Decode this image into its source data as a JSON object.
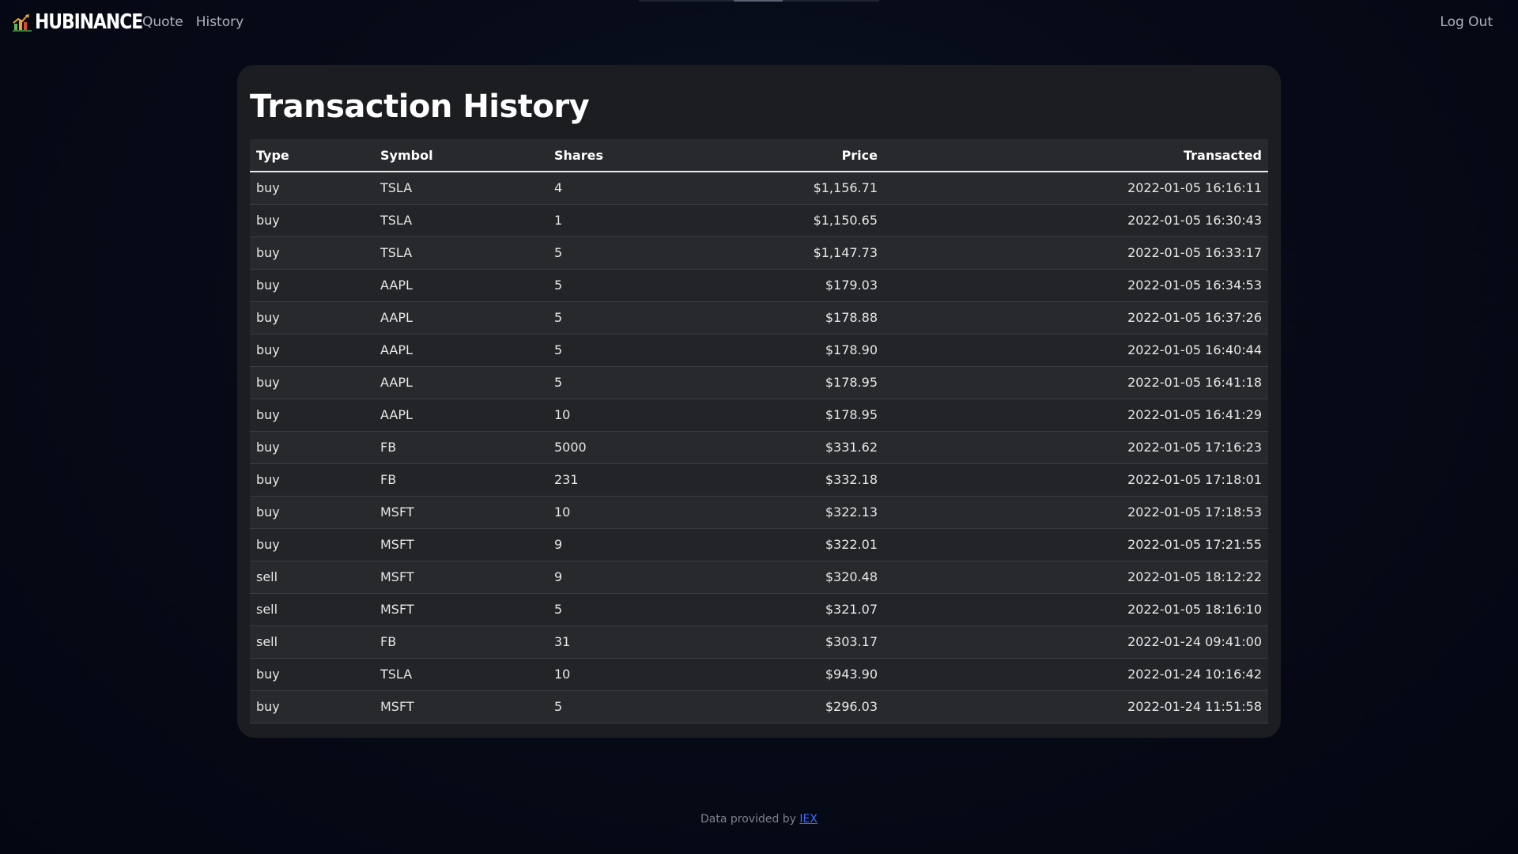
{
  "nav": {
    "brand": "HUBINANCE",
    "links": [
      "Quote",
      "History"
    ],
    "logout": "Log Out"
  },
  "page": {
    "title": "Transaction History"
  },
  "table": {
    "headers": [
      "Type",
      "Symbol",
      "Shares",
      "Price",
      "Transacted"
    ],
    "rows": [
      {
        "type": "buy",
        "symbol": "TSLA",
        "shares": "4",
        "price": "$1,156.71",
        "transacted": "2022-01-05 16:16:11"
      },
      {
        "type": "buy",
        "symbol": "TSLA",
        "shares": "1",
        "price": "$1,150.65",
        "transacted": "2022-01-05 16:30:43"
      },
      {
        "type": "buy",
        "symbol": "TSLA",
        "shares": "5",
        "price": "$1,147.73",
        "transacted": "2022-01-05 16:33:17"
      },
      {
        "type": "buy",
        "symbol": "AAPL",
        "shares": "5",
        "price": "$179.03",
        "transacted": "2022-01-05 16:34:53"
      },
      {
        "type": "buy",
        "symbol": "AAPL",
        "shares": "5",
        "price": "$178.88",
        "transacted": "2022-01-05 16:37:26"
      },
      {
        "type": "buy",
        "symbol": "AAPL",
        "shares": "5",
        "price": "$178.90",
        "transacted": "2022-01-05 16:40:44"
      },
      {
        "type": "buy",
        "symbol": "AAPL",
        "shares": "5",
        "price": "$178.95",
        "transacted": "2022-01-05 16:41:18"
      },
      {
        "type": "buy",
        "symbol": "AAPL",
        "shares": "10",
        "price": "$178.95",
        "transacted": "2022-01-05 16:41:29"
      },
      {
        "type": "buy",
        "symbol": "FB",
        "shares": "5000",
        "price": "$331.62",
        "transacted": "2022-01-05 17:16:23"
      },
      {
        "type": "buy",
        "symbol": "FB",
        "shares": "231",
        "price": "$332.18",
        "transacted": "2022-01-05 17:18:01"
      },
      {
        "type": "buy",
        "symbol": "MSFT",
        "shares": "10",
        "price": "$322.13",
        "transacted": "2022-01-05 17:18:53"
      },
      {
        "type": "buy",
        "symbol": "MSFT",
        "shares": "9",
        "price": "$322.01",
        "transacted": "2022-01-05 17:21:55"
      },
      {
        "type": "sell",
        "symbol": "MSFT",
        "shares": "9",
        "price": "$320.48",
        "transacted": "2022-01-05 18:12:22"
      },
      {
        "type": "sell",
        "symbol": "MSFT",
        "shares": "5",
        "price": "$321.07",
        "transacted": "2022-01-05 18:16:10"
      },
      {
        "type": "sell",
        "symbol": "FB",
        "shares": "31",
        "price": "$303.17",
        "transacted": "2022-01-24 09:41:00"
      },
      {
        "type": "buy",
        "symbol": "TSLA",
        "shares": "10",
        "price": "$943.90",
        "transacted": "2022-01-24 10:16:42"
      },
      {
        "type": "buy",
        "symbol": "MSFT",
        "shares": "5",
        "price": "$296.03",
        "transacted": "2022-01-24 11:51:58"
      }
    ]
  },
  "footer": {
    "prefix": "Data provided by",
    "link": "IEX"
  },
  "icons": {
    "brand_logo": "chart-logo-icon"
  },
  "colors": {
    "background": "#050914",
    "panel": "#1b1d20",
    "link": "#3f6cff",
    "logo_bars": [
      "#e8a33d",
      "#5fb85a",
      "#d94a3a"
    ]
  }
}
